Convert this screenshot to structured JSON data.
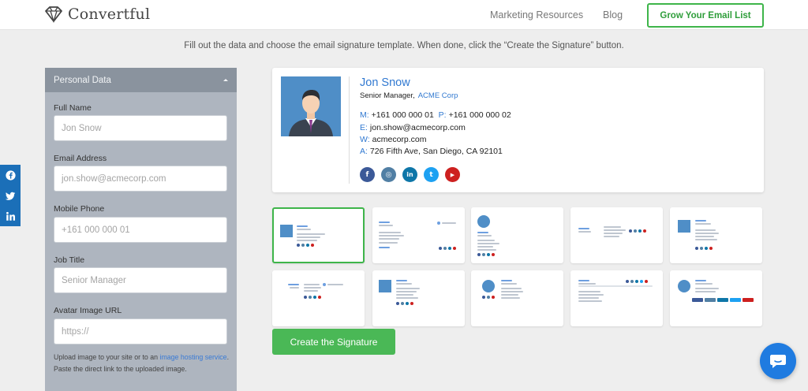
{
  "header": {
    "brand": "Convertful",
    "nav": {
      "resources": "Marketing Resources",
      "blog": "Blog"
    },
    "cta": "Grow Your Email List"
  },
  "instructions": "Fill out the data and choose the email signature template. When done, click the “Create the Signature” button.",
  "panel": {
    "title": "Personal Data",
    "fields": {
      "full_name": {
        "label": "Full Name",
        "placeholder": "Jon Snow"
      },
      "email": {
        "label": "Email Address",
        "placeholder": "jon.show@acmecorp.com"
      },
      "mobile": {
        "label": "Mobile Phone",
        "placeholder": "+161 000 000 01"
      },
      "job_title": {
        "label": "Job Title",
        "placeholder": "Senior Manager"
      },
      "avatar": {
        "label": "Avatar Image URL",
        "placeholder": "https://"
      }
    },
    "helper": {
      "pre": "Upload image to your site or to an ",
      "link": "image hosting service",
      "post": ". Paste the direct link to the uploaded image."
    }
  },
  "share": [
    "facebook-icon",
    "twitter-icon",
    "linkedin-icon"
  ],
  "signature": {
    "name": "Jon Snow",
    "title": "Senior Manager,",
    "company": "ACME Corp",
    "mobile_key": "M:",
    "mobile": "+161 000 000 01",
    "phone_key": "P:",
    "phone": "+161 000 000 02",
    "email_key": "E:",
    "email": "jon.show@acmecorp.com",
    "web_key": "W:",
    "web": "acmecorp.com",
    "address_key": "A:",
    "address": "726 Fifth Ave,  San Diego, CA 92101",
    "socials": [
      {
        "icon": "facebook-icon",
        "glyph": "f",
        "color": "#3b5998"
      },
      {
        "icon": "instagram-icon",
        "glyph": "◎",
        "color": "#517fa4"
      },
      {
        "icon": "linkedin-icon",
        "glyph": "in",
        "color": "#0e76a8"
      },
      {
        "icon": "twitter-icon",
        "glyph": "t",
        "color": "#1da1f2"
      },
      {
        "icon": "youtube-icon",
        "glyph": "▶",
        "color": "#cd201f"
      }
    ]
  },
  "templates": {
    "count": 10,
    "selected": 1
  },
  "create_button": "Create the Signature",
  "colors": {
    "accent_green": "#4ab856",
    "link_blue": "#3179d1",
    "panel_bg": "#aeb5bf"
  }
}
